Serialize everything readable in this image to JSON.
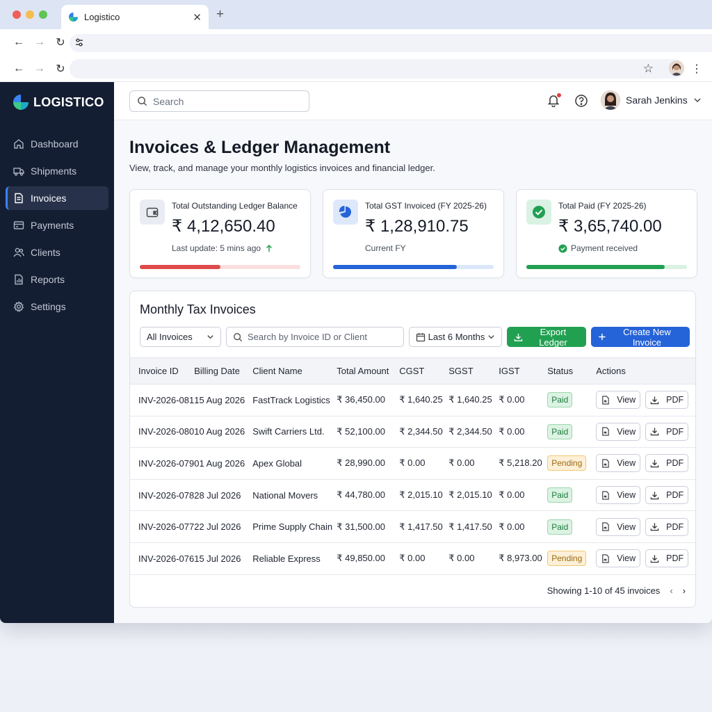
{
  "browser": {
    "tab_title": "Logistico",
    "tab_close": "✕",
    "new_tab": "+"
  },
  "app": {
    "logo_text": "LOGISTICO",
    "colors": {
      "sidebar": "#141e33",
      "accent": "#2563d8",
      "success": "#22a052",
      "danger": "#e04a4a"
    }
  },
  "sidebar": {
    "items": [
      {
        "label": "Dashboard",
        "icon": "home-icon"
      },
      {
        "label": "Shipments",
        "icon": "truck-icon"
      },
      {
        "label": "Invoices",
        "icon": "document-icon",
        "active": true
      },
      {
        "label": "Payments",
        "icon": "credit-card-icon"
      },
      {
        "label": "Clients",
        "icon": "users-icon"
      },
      {
        "label": "Reports",
        "icon": "chart-icon"
      },
      {
        "label": "Settings",
        "icon": "gear-icon"
      }
    ]
  },
  "topbar": {
    "search_placeholder": "Search",
    "user_name": "Sarah Jenkins"
  },
  "page": {
    "title": "Invoices & Ledger Management",
    "subtitle": "View, track, and manage your monthly logistics invoices and financial ledger."
  },
  "cards": [
    {
      "label": "Total Outstanding Ledger Balance",
      "value": "₹ 4,12,650.40",
      "foot": "Last update: 5 mins ago",
      "foot_icon": "arrow-up-icon",
      "progress": 0.5,
      "bar_color": "#e04a4a",
      "track_color": "#fbdfe0"
    },
    {
      "label": "Total GST Invoiced (FY 2025-26)",
      "value": "₹ 1,28,910.75",
      "foot": "Current FY",
      "progress": 0.77,
      "bar_color": "#2563d8",
      "track_color": "#dce7fa"
    },
    {
      "label": "Total Paid (FY 2025-26)",
      "value": "₹ 3,65,740.00",
      "foot": "Payment received",
      "foot_icon": "check-circle-icon",
      "progress": 0.86,
      "bar_color": "#22a052",
      "track_color": "#d9f2e2"
    }
  ],
  "table_panel": {
    "title": "Monthly Tax Invoices",
    "filter_select": "All Invoices",
    "search_placeholder": "Search by Invoice ID or Client",
    "date_range": "Last 6 Months",
    "export_label": "Export Ledger",
    "create_label": "Create New Invoice",
    "columns": [
      "Invoice ID",
      "Billing Date",
      "Client Name",
      "Total Amount",
      "CGST",
      "SGST",
      "IGST",
      "Status",
      "Actions"
    ],
    "rows": [
      {
        "id": "INV-2026-081",
        "date": "15 Aug 2026",
        "client": "FastTrack Logistics",
        "amount": "₹ 36,450.00",
        "cgst": "₹ 1,640.25",
        "sgst": "₹ 1,640.25",
        "igst": "₹ 0.00",
        "status": "Paid"
      },
      {
        "id": "INV-2026-080",
        "date": "10 Aug 2026",
        "client": "Swift Carriers Ltd.",
        "amount": "₹ 52,100.00",
        "cgst": "₹ 2,344.50",
        "sgst": "₹ 2,344.50",
        "igst": "₹ 0.00",
        "status": "Paid"
      },
      {
        "id": "INV-2026-079",
        "date": "01 Aug 2026",
        "client": "Apex Global",
        "amount": "₹ 28,990.00",
        "cgst": "₹ 0.00",
        "sgst": "₹ 0.00",
        "igst": "₹ 5,218.20",
        "status": "Pending"
      },
      {
        "id": "INV-2026-078",
        "date": "28 Jul 2026",
        "client": "National Movers",
        "amount": "₹ 44,780.00",
        "cgst": "₹ 2,015.10",
        "sgst": "₹ 2,015.10",
        "igst": "₹ 0.00",
        "status": "Paid"
      },
      {
        "id": "INV-2026-077",
        "date": "22 Jul 2026",
        "client": "Prime Supply Chain",
        "amount": "₹ 31,500.00",
        "cgst": "₹ 1,417.50",
        "sgst": "₹ 1,417.50",
        "igst": "₹ 0.00",
        "status": "Paid"
      },
      {
        "id": "INV-2026-076",
        "date": "15 Jul 2026",
        "client": "Reliable Express",
        "amount": "₹ 49,850.00",
        "cgst": "₹ 0.00",
        "sgst": "₹ 0.00",
        "igst": "₹ 8,973.00",
        "status": "Pending"
      }
    ],
    "view_label": "View",
    "pdf_label": "PDF",
    "pagination": "Showing 1-10 of 45 invoices"
  }
}
